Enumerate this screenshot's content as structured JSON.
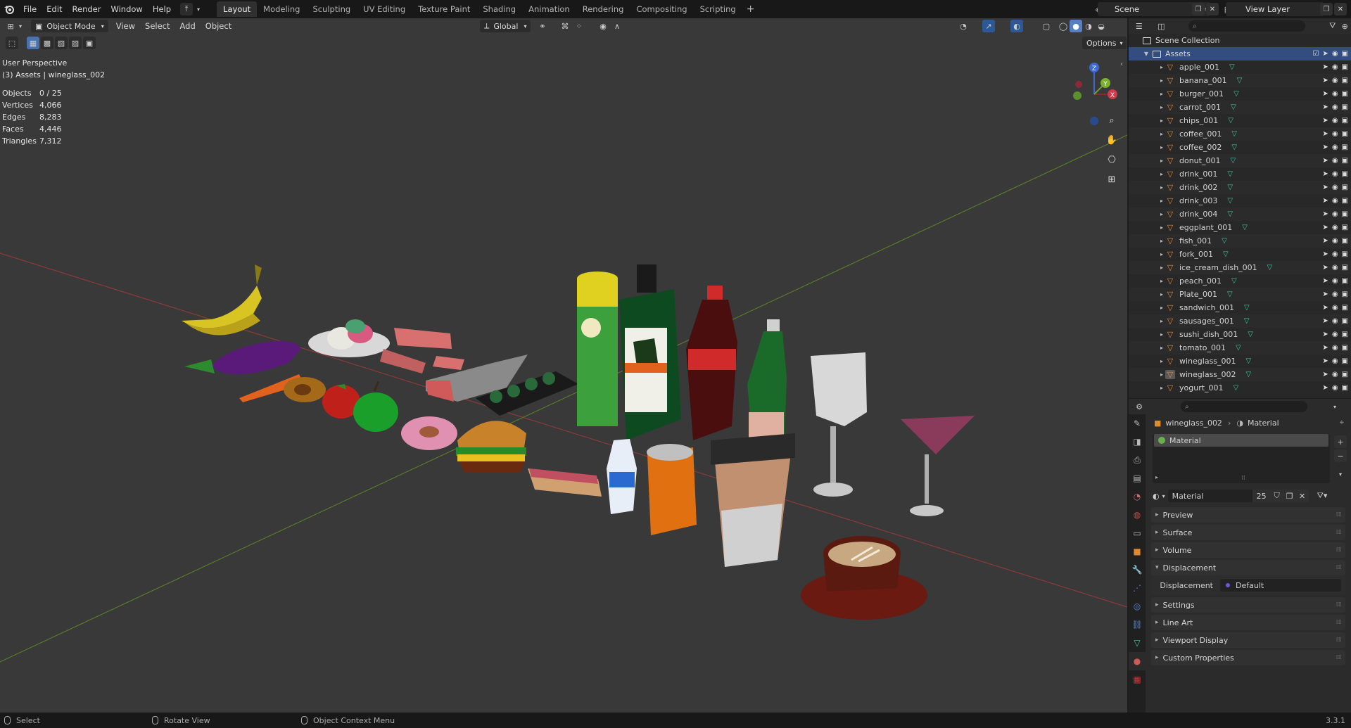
{
  "top_menu": [
    "File",
    "Edit",
    "Render",
    "Window",
    "Help"
  ],
  "workspaces": [
    "Layout",
    "Modeling",
    "Sculpting",
    "UV Editing",
    "Texture Paint",
    "Shading",
    "Animation",
    "Rendering",
    "Compositing",
    "Scripting"
  ],
  "active_workspace": "Layout",
  "scene_name": "Scene",
  "view_layer": "View Layer",
  "viewport_header": {
    "mode": "Object Mode",
    "menus": [
      "View",
      "Select",
      "Add",
      "Object"
    ],
    "orientation": "Global",
    "options": "Options"
  },
  "viewport_info": {
    "perspective": "User Perspective",
    "collection_label": "(3) Assets | wineglass_002",
    "stats": [
      {
        "k": "Objects",
        "v": "0 / 25"
      },
      {
        "k": "Vertices",
        "v": "4,066"
      },
      {
        "k": "Edges",
        "v": "8,283"
      },
      {
        "k": "Faces",
        "v": "4,446"
      },
      {
        "k": "Triangles",
        "v": "7,312"
      }
    ]
  },
  "gizmo": {
    "x": "X",
    "y": "Y",
    "z": "Z"
  },
  "outliner": {
    "root": "Scene Collection",
    "collection": "Assets",
    "objects": [
      "apple_001",
      "banana_001",
      "burger_001",
      "carrot_001",
      "chips_001",
      "coffee_001",
      "coffee_002",
      "donut_001",
      "drink_001",
      "drink_002",
      "drink_003",
      "drink_004",
      "eggplant_001",
      "fish_001",
      "fork_001",
      "ice_cream_dish_001",
      "peach_001",
      "Plate_001",
      "sandwich_001",
      "sausages_001",
      "sushi_dish_001",
      "tomato_001",
      "wineglass_001",
      "wineglass_002",
      "yogurt_001"
    ]
  },
  "properties": {
    "object_name": "wineglass_002",
    "material_tab": "Material",
    "slot_name": "Material",
    "material_name": "Material",
    "users": "25",
    "panels": [
      "Preview",
      "Surface",
      "Volume",
      "Displacement",
      "Settings",
      "Line Art",
      "Viewport Display",
      "Custom Properties"
    ],
    "displacement_label": "Displacement",
    "displacement_value": "Default"
  },
  "status_bar": {
    "select": "Select",
    "rotate": "Rotate View",
    "context": "Object Context Menu",
    "version": "3.3.1"
  }
}
